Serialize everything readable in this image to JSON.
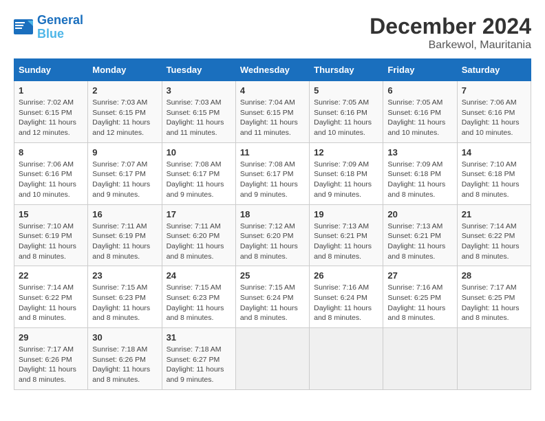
{
  "logo": {
    "line1": "General",
    "line2": "Blue"
  },
  "title": "December 2024",
  "location": "Barkewol, Mauritania",
  "days_of_week": [
    "Sunday",
    "Monday",
    "Tuesday",
    "Wednesday",
    "Thursday",
    "Friday",
    "Saturday"
  ],
  "weeks": [
    [
      {
        "day": "1",
        "info": "Sunrise: 7:02 AM\nSunset: 6:15 PM\nDaylight: 11 hours\nand 12 minutes."
      },
      {
        "day": "2",
        "info": "Sunrise: 7:03 AM\nSunset: 6:15 PM\nDaylight: 11 hours\nand 12 minutes."
      },
      {
        "day": "3",
        "info": "Sunrise: 7:03 AM\nSunset: 6:15 PM\nDaylight: 11 hours\nand 11 minutes."
      },
      {
        "day": "4",
        "info": "Sunrise: 7:04 AM\nSunset: 6:15 PM\nDaylight: 11 hours\nand 11 minutes."
      },
      {
        "day": "5",
        "info": "Sunrise: 7:05 AM\nSunset: 6:16 PM\nDaylight: 11 hours\nand 10 minutes."
      },
      {
        "day": "6",
        "info": "Sunrise: 7:05 AM\nSunset: 6:16 PM\nDaylight: 11 hours\nand 10 minutes."
      },
      {
        "day": "7",
        "info": "Sunrise: 7:06 AM\nSunset: 6:16 PM\nDaylight: 11 hours\nand 10 minutes."
      }
    ],
    [
      {
        "day": "8",
        "info": "Sunrise: 7:06 AM\nSunset: 6:16 PM\nDaylight: 11 hours\nand 10 minutes."
      },
      {
        "day": "9",
        "info": "Sunrise: 7:07 AM\nSunset: 6:17 PM\nDaylight: 11 hours\nand 9 minutes."
      },
      {
        "day": "10",
        "info": "Sunrise: 7:08 AM\nSunset: 6:17 PM\nDaylight: 11 hours\nand 9 minutes."
      },
      {
        "day": "11",
        "info": "Sunrise: 7:08 AM\nSunset: 6:17 PM\nDaylight: 11 hours\nand 9 minutes."
      },
      {
        "day": "12",
        "info": "Sunrise: 7:09 AM\nSunset: 6:18 PM\nDaylight: 11 hours\nand 9 minutes."
      },
      {
        "day": "13",
        "info": "Sunrise: 7:09 AM\nSunset: 6:18 PM\nDaylight: 11 hours\nand 8 minutes."
      },
      {
        "day": "14",
        "info": "Sunrise: 7:10 AM\nSunset: 6:18 PM\nDaylight: 11 hours\nand 8 minutes."
      }
    ],
    [
      {
        "day": "15",
        "info": "Sunrise: 7:10 AM\nSunset: 6:19 PM\nDaylight: 11 hours\nand 8 minutes."
      },
      {
        "day": "16",
        "info": "Sunrise: 7:11 AM\nSunset: 6:19 PM\nDaylight: 11 hours\nand 8 minutes."
      },
      {
        "day": "17",
        "info": "Sunrise: 7:11 AM\nSunset: 6:20 PM\nDaylight: 11 hours\nand 8 minutes."
      },
      {
        "day": "18",
        "info": "Sunrise: 7:12 AM\nSunset: 6:20 PM\nDaylight: 11 hours\nand 8 minutes."
      },
      {
        "day": "19",
        "info": "Sunrise: 7:13 AM\nSunset: 6:21 PM\nDaylight: 11 hours\nand 8 minutes."
      },
      {
        "day": "20",
        "info": "Sunrise: 7:13 AM\nSunset: 6:21 PM\nDaylight: 11 hours\nand 8 minutes."
      },
      {
        "day": "21",
        "info": "Sunrise: 7:14 AM\nSunset: 6:22 PM\nDaylight: 11 hours\nand 8 minutes."
      }
    ],
    [
      {
        "day": "22",
        "info": "Sunrise: 7:14 AM\nSunset: 6:22 PM\nDaylight: 11 hours\nand 8 minutes."
      },
      {
        "day": "23",
        "info": "Sunrise: 7:15 AM\nSunset: 6:23 PM\nDaylight: 11 hours\nand 8 minutes."
      },
      {
        "day": "24",
        "info": "Sunrise: 7:15 AM\nSunset: 6:23 PM\nDaylight: 11 hours\nand 8 minutes."
      },
      {
        "day": "25",
        "info": "Sunrise: 7:15 AM\nSunset: 6:24 PM\nDaylight: 11 hours\nand 8 minutes."
      },
      {
        "day": "26",
        "info": "Sunrise: 7:16 AM\nSunset: 6:24 PM\nDaylight: 11 hours\nand 8 minutes."
      },
      {
        "day": "27",
        "info": "Sunrise: 7:16 AM\nSunset: 6:25 PM\nDaylight: 11 hours\nand 8 minutes."
      },
      {
        "day": "28",
        "info": "Sunrise: 7:17 AM\nSunset: 6:25 PM\nDaylight: 11 hours\nand 8 minutes."
      }
    ],
    [
      {
        "day": "29",
        "info": "Sunrise: 7:17 AM\nSunset: 6:26 PM\nDaylight: 11 hours\nand 8 minutes."
      },
      {
        "day": "30",
        "info": "Sunrise: 7:18 AM\nSunset: 6:26 PM\nDaylight: 11 hours\nand 8 minutes."
      },
      {
        "day": "31",
        "info": "Sunrise: 7:18 AM\nSunset: 6:27 PM\nDaylight: 11 hours\nand 9 minutes."
      },
      {
        "day": "",
        "info": ""
      },
      {
        "day": "",
        "info": ""
      },
      {
        "day": "",
        "info": ""
      },
      {
        "day": "",
        "info": ""
      }
    ]
  ]
}
